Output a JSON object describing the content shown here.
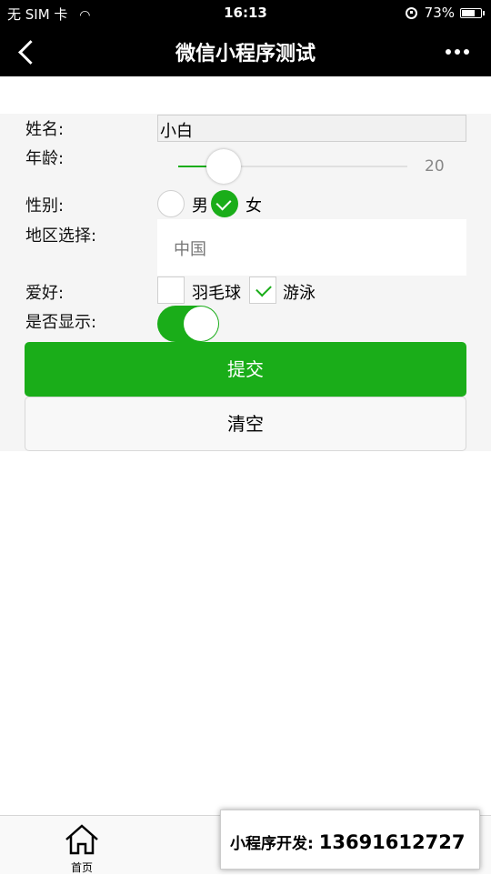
{
  "status_bar": {
    "carrier": "无 SIM 卡",
    "time": "16:13",
    "battery": "73%",
    "battery_level": 0.73
  },
  "nav": {
    "title": "微信小程序测试"
  },
  "form": {
    "name_label": "姓名:",
    "name_value": "小白",
    "age_label": "年龄:",
    "age_value": "20",
    "age_fraction": 0.2,
    "gender_label": "性别:",
    "gender_options": [
      "男",
      "女"
    ],
    "gender_selected": "女",
    "region_label": "地区选择:",
    "region_value": "中国",
    "hobby_label": "爱好:",
    "hobby_options": [
      "羽毛球",
      "游泳"
    ],
    "hobby_checked": [
      "游泳"
    ],
    "display_label": "是否显示:",
    "display_on": true,
    "submit_label": "提交",
    "clear_label": "清空"
  },
  "tab_bar": {
    "home_label": "首页"
  },
  "overlay": {
    "contact_prefix": "小程序开发:",
    "contact_number": "13691612727"
  },
  "colors": {
    "accent": "#1aad19",
    "bar_bg": "#000000"
  }
}
